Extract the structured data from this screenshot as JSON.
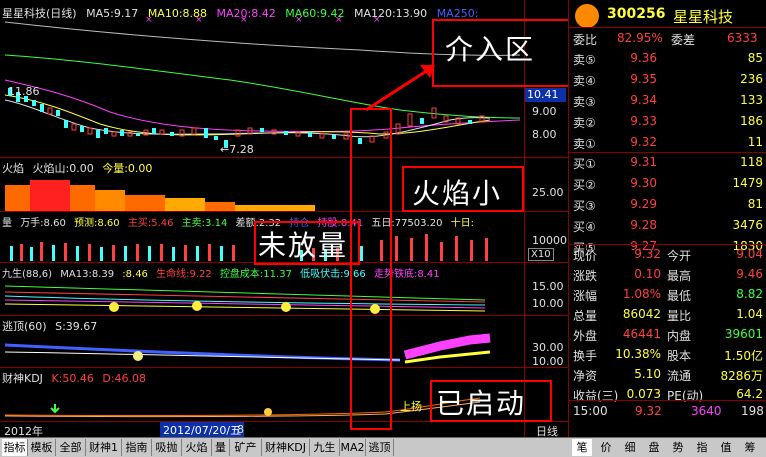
{
  "header": {
    "name": "星星科技(日线)",
    "ma5": "MA5:9.17",
    "ma10": "MA10:8.88",
    "ma20": "MA20:8.42",
    "ma60": "MA60:9.42",
    "ma120": "MA120:13.90",
    "ma250": "MA250:"
  },
  "price_axis": {
    "box": "10.41",
    "l1": "9.00",
    "l2": "8.00"
  },
  "chart_marks": {
    "high": "11.86",
    "low": "←7.28"
  },
  "panels": {
    "huoyan": {
      "t1": "火焰",
      "t2": "火焰山:0.00",
      "t3": "今量:0.00",
      "axis": "25.00"
    },
    "liang": {
      "t1": "量",
      "t2": "万手:8.60",
      "t3": "预测:8.60",
      "t4": "主买:5.46",
      "t5": "主卖:3.14",
      "t6": "差额:2.32",
      "t7": "持仓",
      "t8": "持股:8.41",
      "t9": "五日:77503.20",
      "t10": "十日:",
      "axis": "10000",
      "axis2": "X10"
    },
    "jiusheng": {
      "t1": "九生(88,6)",
      "t2": "MA13:8.39",
      "t3": ":8.46",
      "t4": "生命线:9.22",
      "t5": "控盘成本:11.37",
      "t6": "低吸伏击:9.66",
      "t7": "走势铁底:8.41",
      "axis1": "15.00",
      "axis2": "10.00"
    },
    "taoding": {
      "t1": "逃顶(60)",
      "t2": "S:39.67",
      "axis1": "30.00",
      "axis2": "10.00"
    },
    "kdj": {
      "t1": "财神KDJ",
      "t2": "K:50.46",
      "t3": "D:46.08",
      "t4": "上扬"
    }
  },
  "date_row": {
    "year": "2012年",
    "date": "2012/07/20/五",
    "num": "8",
    "period": "日线"
  },
  "annotations": {
    "a1": "介入区",
    "a2": "火焰小",
    "a3": "未放量",
    "a4": "已启动"
  },
  "right_panel": {
    "code": "300256",
    "name": "星星科技",
    "weibi_label": "委比",
    "weibi": "82.95%",
    "weicha_label": "委差",
    "weicha": "6333",
    "sells": [
      {
        "label": "卖⑤",
        "price": "9.36",
        "vol": "85"
      },
      {
        "label": "卖④",
        "price": "9.35",
        "vol": "236"
      },
      {
        "label": "卖③",
        "price": "9.34",
        "vol": "133"
      },
      {
        "label": "卖②",
        "price": "9.33",
        "vol": "186"
      },
      {
        "label": "卖①",
        "price": "9.32",
        "vol": "11"
      }
    ],
    "buys": [
      {
        "label": "买①",
        "price": "9.31",
        "vol": "118"
      },
      {
        "label": "买②",
        "price": "9.30",
        "vol": "1479"
      },
      {
        "label": "买③",
        "price": "9.29",
        "vol": "81"
      },
      {
        "label": "买④",
        "price": "9.28",
        "vol": "3476"
      },
      {
        "label": "买⑤",
        "price": "9.27",
        "vol": "1830"
      }
    ],
    "stats": [
      {
        "l1": "现价",
        "v1": "9.32",
        "l2": "今开",
        "v2": "9.04",
        "c1": "#ff4040",
        "c2": "#ff4040"
      },
      {
        "l1": "涨跌",
        "v1": "0.10",
        "l2": "最高",
        "v2": "9.46",
        "c1": "#ff4040",
        "c2": "#ff4040"
      },
      {
        "l1": "涨幅",
        "v1": "1.08%",
        "l2": "最低",
        "v2": "8.82",
        "c1": "#ff4040",
        "c2": "#40ff40"
      },
      {
        "l1": "总量",
        "v1": "86042",
        "l2": "量比",
        "v2": "1.04",
        "c1": "#ffff40",
        "c2": "#ffff40"
      },
      {
        "l1": "外盘",
        "v1": "46441",
        "l2": "内盘",
        "v2": "39601",
        "c1": "#ff4040",
        "c2": "#40ff40"
      },
      {
        "l1": "换手",
        "v1": "10.38%",
        "l2": "股本",
        "v2": "1.50亿",
        "c1": "#ffff40",
        "c2": "#ffff40"
      },
      {
        "l1": "净资",
        "v1": "5.10",
        "l2": "流通",
        "v2": "8286万",
        "c1": "#ffff40",
        "c2": "#ffff40"
      },
      {
        "l1": "收益(三)",
        "v1": "0.073",
        "l2": "PE(动)",
        "v2": "64.2",
        "c1": "#ffff40",
        "c2": "#ffff40"
      }
    ],
    "last_trade": {
      "time": "15:00",
      "price": "9.32",
      "vol": "3640",
      "num": "198"
    }
  },
  "bottom_tabs": [
    "指标",
    "模板",
    "全部",
    "财神1",
    "指南",
    "吸抛",
    "火焰",
    "量",
    "矿产",
    "财神KDJ",
    "九生",
    "MA2",
    "逃顶"
  ],
  "right_tabs": [
    "笔",
    "价",
    "细",
    "盘",
    "势",
    "指",
    "值",
    "筹"
  ],
  "colors": {
    "up": "#ff4040",
    "down": "#40ff40",
    "accent": "#ffff40",
    "border": "#8a0000"
  }
}
